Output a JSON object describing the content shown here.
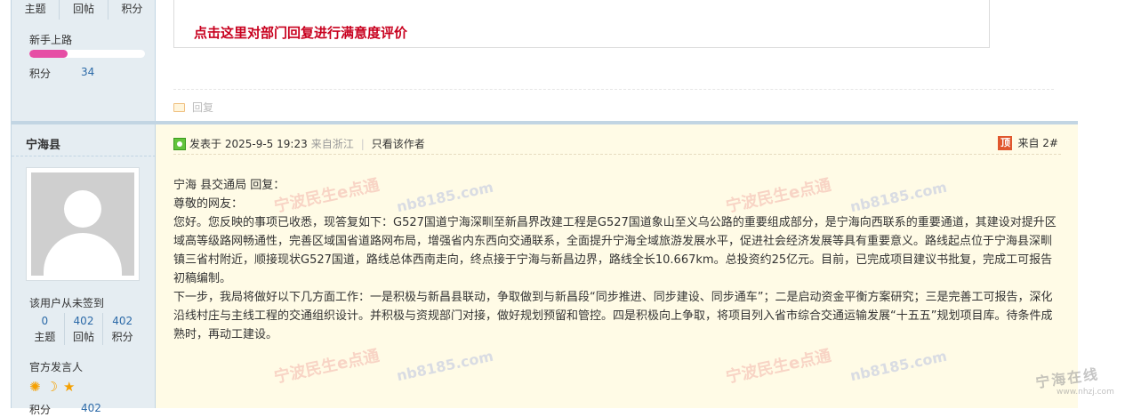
{
  "prev_post": {
    "stats": [
      "主题",
      "回帖",
      "积分"
    ],
    "group": "新手上路",
    "progress_fraction": 0.33,
    "credits_label": "积分",
    "credits_value": "34",
    "eval_link": "点击这里对部门回复进行满意度评价",
    "reply_action": "回复"
  },
  "author": {
    "name": "宁海县",
    "signin_status": "该用户从未签到",
    "stats": [
      {
        "num": "0",
        "label": "主题"
      },
      {
        "num": "402",
        "label": "回帖"
      },
      {
        "num": "402",
        "label": "积分"
      }
    ],
    "group": "官方发言人",
    "medals": [
      "sun-medal-icon",
      "moon-medal-icon",
      "star-medal-icon"
    ],
    "credits_label": "积分",
    "credits_value": "402"
  },
  "post": {
    "posted_prefix": "发表于",
    "posted_time": "2025-9-5 19:23",
    "posted_from": "来自浙江",
    "only_author": "只看该作者",
    "top_badge": "顶",
    "floor": "来自 2#",
    "lines": [
      "宁海 县交通局 回复：",
      "尊敬的网友：",
      "您好。您反映的事项已收悉，现答复如下：G527国道宁海深甽至新昌界改建工程是G527国道象山至义乌公路的重要组成部分，是宁海向西联系的重要通道，其建设对提升区域高等级路网畅通性，完善区域国省道路网布局，增强省内东西向交通联系，全面提升宁海全域旅游发展水平，促进社会经济发展等具有重要意义。路线起点位于宁海县深甽镇三省村附近，顺接现状G527国道，路线总体西南走向，终点接于宁海与新昌边界，路线全长10.667km。总投资约25亿元。目前，已完成项目建议书批复，完成工可报告初稿编制。",
      "下一步，我局将做好以下几方面工作：一是积极与新昌县联动，争取做到与新昌段“同步推进、同步建设、同步通车”；二是启动资金平衡方案研究；三是完善工可报告，深化沿线村庄与主线工程的交通组织设计。并积极与资规部门对接，做好规划预留和管控。四是积极向上争取，将项目列入省市综合交通运输发展“十五五”规划项目库。待条件成熟时，再动工建设。"
    ]
  },
  "watermark": {
    "brand": "宁波民生e点通",
    "url": "nb8185.com",
    "site_logo": "宁海在线",
    "site_url": "www.nhzj.com"
  },
  "colors": {
    "sidebar_bg": "#e5edf2",
    "post_bg": "#fffbe6",
    "border": "#c2d5e3",
    "eval_link": "#c8001e",
    "link_blue": "#2c6aa8",
    "progress_fill": "#e64ea5"
  }
}
